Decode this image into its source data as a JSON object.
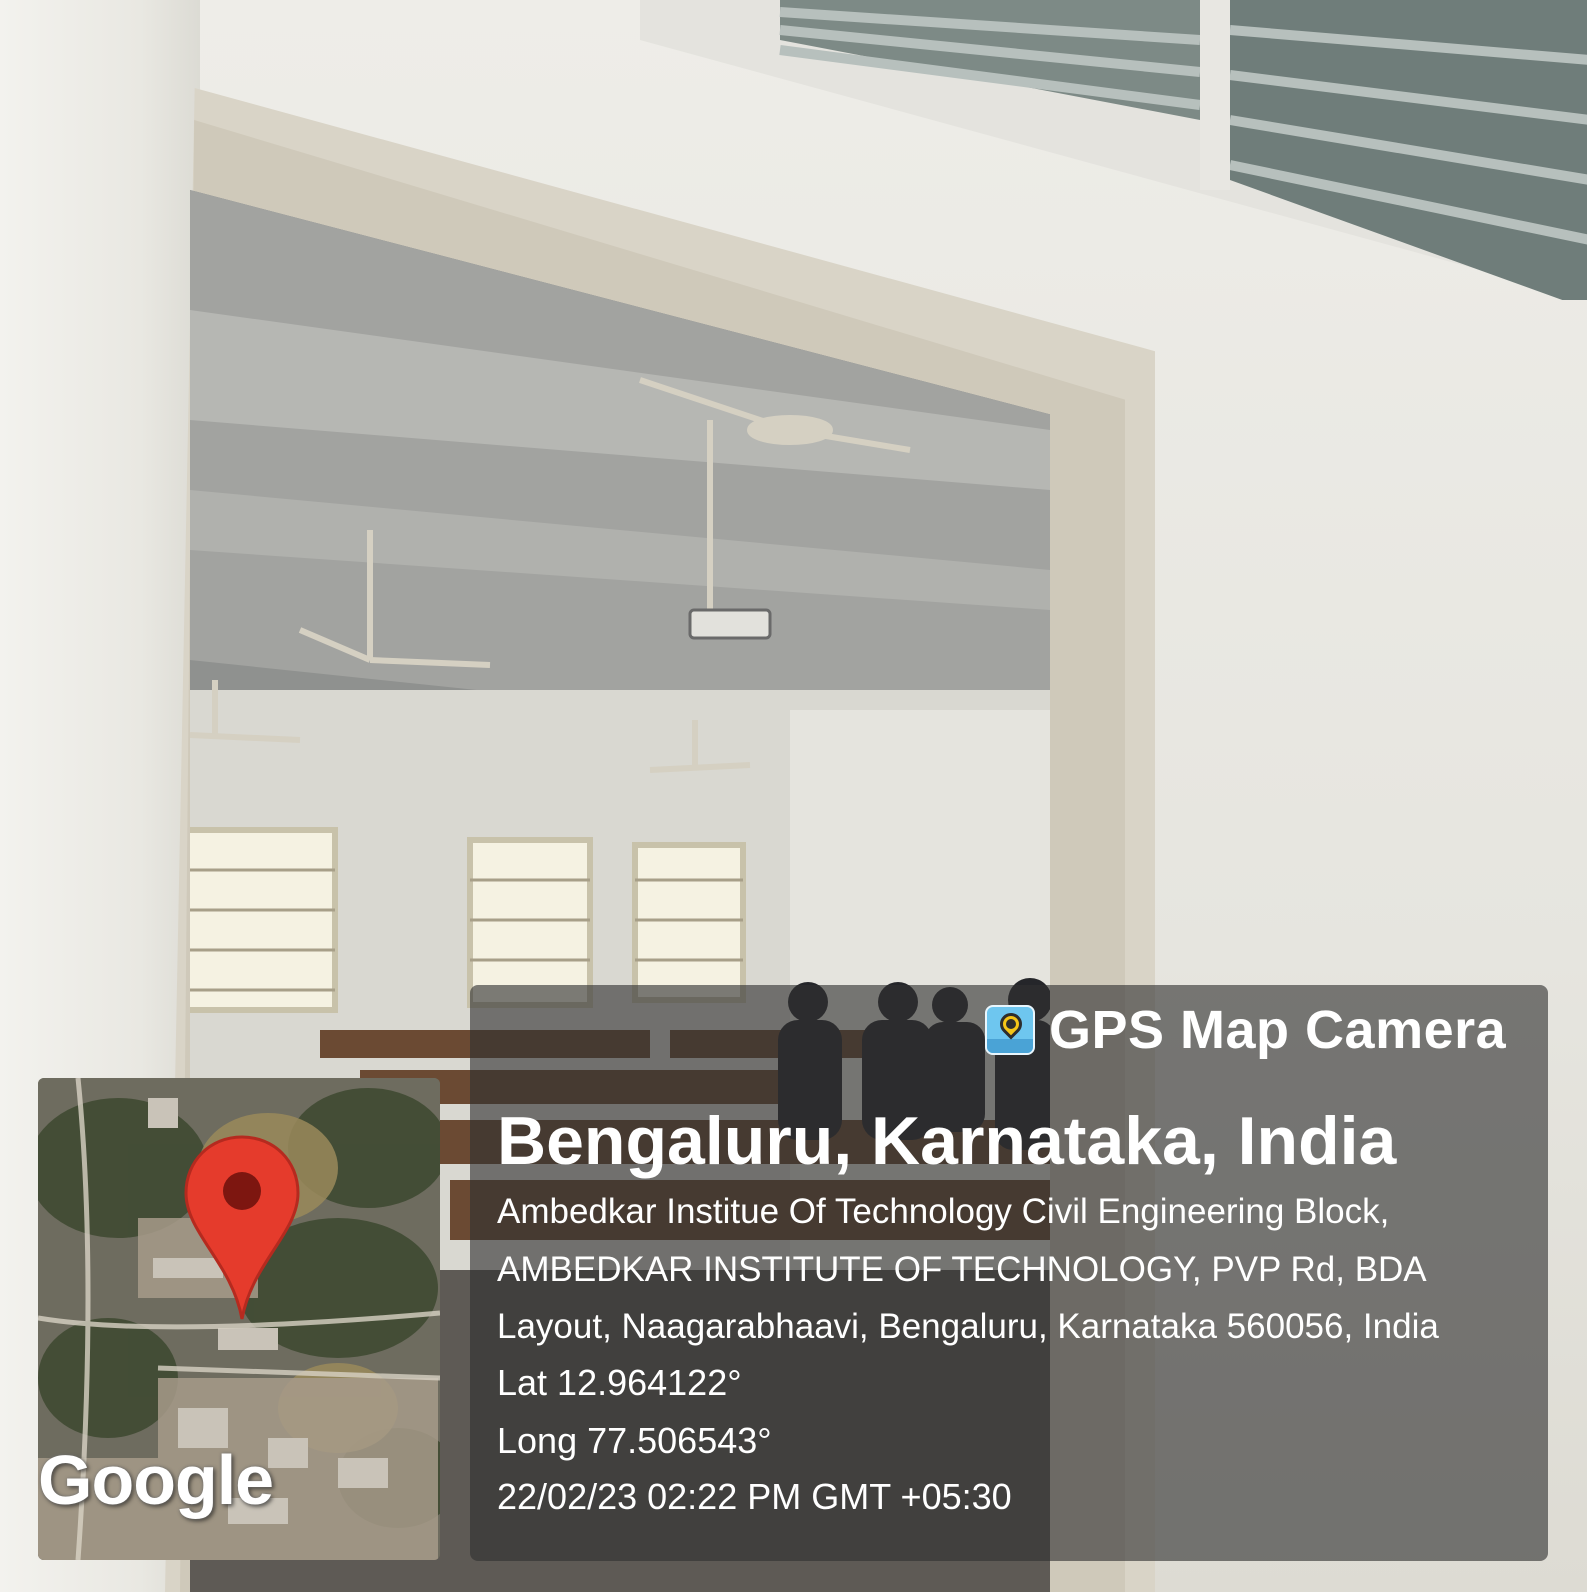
{
  "overlay": {
    "brand": "GPS Map Camera",
    "location_title": "Bengaluru, Karnataka, India",
    "address_lines": [
      "Ambedkar Institue Of Technology Civil Engineering Block,",
      "AMBEDKAR INSTITUTE OF TECHNOLOGY, PVP Rd, BDA",
      "Layout, Naagarabhaavi, Bengaluru, Karnataka 560056, India"
    ],
    "latitude": "Lat 12.964122°",
    "longitude": "Long 77.506543°",
    "datetime": "22/02/23 02:22 PM GMT +05:30",
    "map_attribution": "Google"
  },
  "colors": {
    "overlay_bg": "#303030",
    "pin_red": "#e53b2c",
    "text": "#ffffff"
  }
}
